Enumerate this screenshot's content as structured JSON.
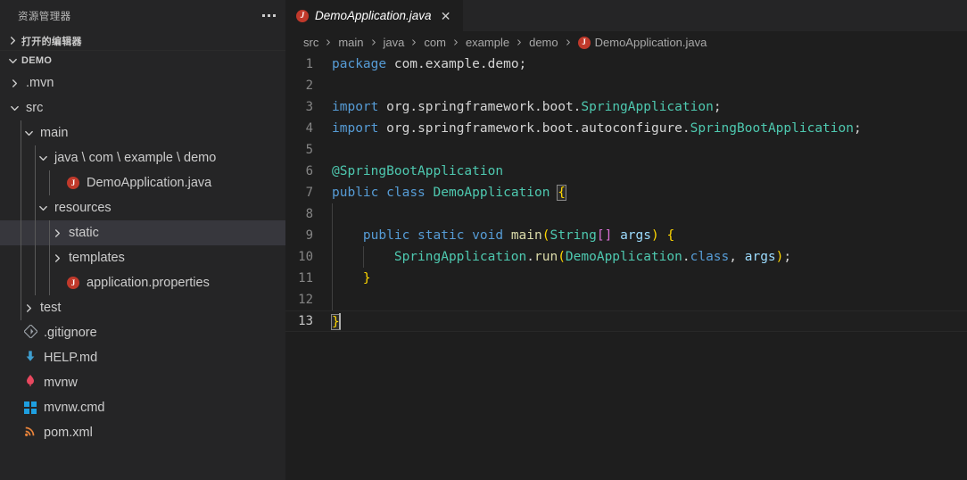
{
  "sidebar": {
    "header_title": "资源管理器",
    "more_actions_icon": "ellipsis-icon",
    "sections": [
      {
        "label": "打开的编辑器",
        "expanded": false
      },
      {
        "label": "DEMO",
        "expanded": true
      }
    ],
    "tree": [
      {
        "label": ".mvn",
        "indent": 1,
        "twisty": "collapsed",
        "icon": "",
        "selected": false
      },
      {
        "label": "src",
        "indent": 1,
        "twisty": "expanded",
        "icon": "",
        "selected": false
      },
      {
        "label": "main",
        "indent": 2,
        "twisty": "expanded",
        "icon": "",
        "selected": false
      },
      {
        "label": "java \\ com \\ example \\ demo",
        "indent": 3,
        "twisty": "expanded",
        "icon": "",
        "selected": false
      },
      {
        "label": "DemoApplication.java",
        "indent": 4,
        "twisty": "none",
        "icon": "java-icon",
        "selected": false
      },
      {
        "label": "resources",
        "indent": 3,
        "twisty": "expanded",
        "icon": "",
        "selected": false
      },
      {
        "label": "static",
        "indent": 4,
        "twisty": "collapsed",
        "icon": "",
        "selected": true
      },
      {
        "label": "templates",
        "indent": 4,
        "twisty": "collapsed",
        "icon": "",
        "selected": false
      },
      {
        "label": "application.properties",
        "indent": 4,
        "twisty": "none",
        "icon": "java-icon",
        "selected": false
      },
      {
        "label": "test",
        "indent": 2,
        "twisty": "collapsed",
        "icon": "",
        "selected": false
      },
      {
        "label": ".gitignore",
        "indent": 1,
        "twisty": "none",
        "icon": "git-icon",
        "selected": false
      },
      {
        "label": "HELP.md",
        "indent": 1,
        "twisty": "none",
        "icon": "markdown-icon",
        "selected": false
      },
      {
        "label": "mvnw",
        "indent": 1,
        "twisty": "none",
        "icon": "maven-icon",
        "selected": false
      },
      {
        "label": "mvnw.cmd",
        "indent": 1,
        "twisty": "none",
        "icon": "windows-icon",
        "selected": false
      },
      {
        "label": "pom.xml",
        "indent": 1,
        "twisty": "none",
        "icon": "xml-icon",
        "selected": false
      }
    ]
  },
  "editor": {
    "tab": {
      "label": "DemoApplication.java",
      "icon": "java-icon",
      "close_icon": "close-icon",
      "preview": true
    },
    "breadcrumb": [
      "src",
      "main",
      "java",
      "com",
      "example",
      "demo",
      "DemoApplication.java"
    ],
    "breadcrumb_last_icon": "java-icon",
    "lines": [
      {
        "n": "1",
        "text": "package com.example.demo;"
      },
      {
        "n": "2",
        "text": ""
      },
      {
        "n": "3",
        "text": "import org.springframework.boot.SpringApplication;"
      },
      {
        "n": "4",
        "text": "import org.springframework.boot.autoconfigure.SpringBootApplication;"
      },
      {
        "n": "5",
        "text": ""
      },
      {
        "n": "6",
        "text": "@SpringBootApplication"
      },
      {
        "n": "7",
        "text": "public class DemoApplication {"
      },
      {
        "n": "8",
        "text": ""
      },
      {
        "n": "9",
        "text": "    public static void main(String[] args) {"
      },
      {
        "n": "10",
        "text": "        SpringApplication.run(DemoApplication.class, args);"
      },
      {
        "n": "11",
        "text": "    }"
      },
      {
        "n": "12",
        "text": ""
      },
      {
        "n": "13",
        "text": "}"
      }
    ],
    "active_line": "13",
    "cursor_position": "line 13, column 2"
  },
  "colors": {
    "sidebar_bg": "#252526",
    "editor_bg": "#1e1e1e",
    "selection_bg": "#37373d",
    "keyword": "#569cd6",
    "type": "#4ec9b0",
    "function": "#dcdcaa",
    "variable": "#9cdcfe",
    "text": "#d4d4d4",
    "line_number": "#858585",
    "java_icon": "#c0392b"
  }
}
